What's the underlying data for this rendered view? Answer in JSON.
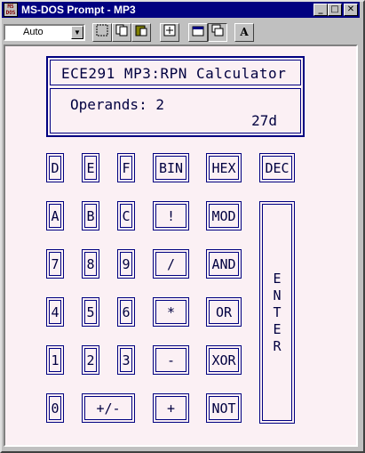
{
  "window": {
    "title": "MS-DOS Prompt - MP3",
    "app_icon_text": "MS DOS",
    "buttons": {
      "minimize": "_",
      "maximize": "□",
      "close": "✕"
    }
  },
  "toolbar": {
    "font_size": "Auto",
    "font_button_label": "A",
    "icons": [
      "mark-icon",
      "copy-icon",
      "paste-icon",
      "fullscreen-icon",
      "properties-icon",
      "background-icon",
      "font-icon"
    ]
  },
  "display": {
    "title": "ECE291 MP3:RPN Calculator",
    "operands": "Operands: 2",
    "result": "27d"
  },
  "keys": {
    "D": "D",
    "E": "E",
    "F": "F",
    "BIN": "BIN",
    "HEX": "HEX",
    "DEC": "DEC",
    "A": "A",
    "B": "B",
    "C": "C",
    "FACT": "!",
    "MOD": "MOD",
    "7": "7",
    "8": "8",
    "9": "9",
    "DIV": "/",
    "AND": "AND",
    "4": "4",
    "5": "5",
    "6": "6",
    "MUL": "*",
    "OR": "OR",
    "1": "1",
    "2": "2",
    "3": "3",
    "SUB": "-",
    "XOR": "XOR",
    "0": "0",
    "NEG": "+/-",
    "ADD": "+",
    "NOT": "NOT",
    "ENTER": "ENTER"
  },
  "colors": {
    "title_bar": "#000080",
    "calc_background": "#fbf0f4",
    "key_border": "#000080"
  }
}
